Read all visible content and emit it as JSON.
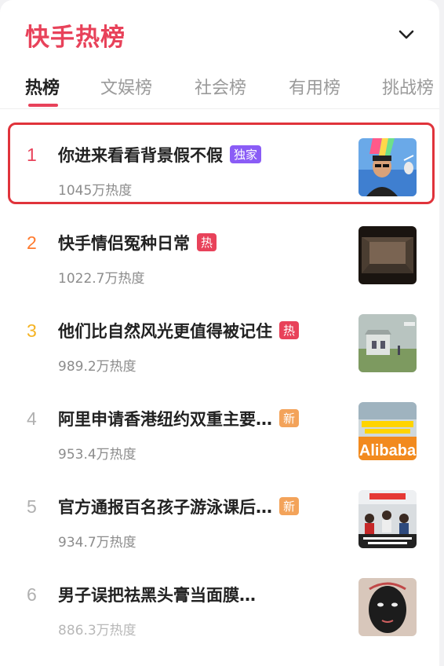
{
  "header": {
    "title": "快手热榜"
  },
  "colors": {
    "accent": "#e8425a",
    "rank1": "#e8425a",
    "rank2": "#ff7a2e",
    "rank3": "#f5b323",
    "badge_exclusive": "#8a5cf6",
    "badge_hot": "#e8425a",
    "badge_new": "#f3a35a"
  },
  "tabs": [
    {
      "label": "热榜",
      "active": true
    },
    {
      "label": "文娱榜",
      "active": false
    },
    {
      "label": "社会榜",
      "active": false
    },
    {
      "label": "有用榜",
      "active": false
    },
    {
      "label": "挑战榜",
      "active": false
    }
  ],
  "items": [
    {
      "rank": "1",
      "title": "你进来看看背景假不假",
      "badge": "独家",
      "badge_type": "exclusive",
      "heat": "1045万热度",
      "highlighted": true,
      "thumb_icon": "man-portrait-thumbnail"
    },
    {
      "rank": "2",
      "title": "快手情侣冤种日常",
      "badge": "热",
      "badge_type": "hot",
      "heat": "1022.7万热度",
      "thumb_icon": "empty-room-thumbnail"
    },
    {
      "rank": "3",
      "title": "他们比自然风光更值得被记住",
      "badge": "热",
      "badge_type": "hot",
      "heat": "989.2万热度",
      "thumb_icon": "outpost-thumbnail"
    },
    {
      "rank": "4",
      "title": "阿里申请香港纽约双重主要…",
      "badge": "新",
      "badge_type": "new",
      "heat": "953.4万热度",
      "thumb_icon": "alibaba-thumbnail"
    },
    {
      "rank": "5",
      "title": "官方通报百名孩子游泳课后…",
      "badge": "新",
      "badge_type": "new",
      "heat": "934.7万热度",
      "thumb_icon": "classroom-thumbnail"
    },
    {
      "rank": "6",
      "title": "男子误把祛黑头膏当面膜…",
      "badge": "",
      "badge_type": "none",
      "heat": "886.3万热度",
      "thumb_icon": "black-mask-face-thumbnail"
    }
  ],
  "thumbnails": {
    "alibaba_text": "Alibaba"
  }
}
